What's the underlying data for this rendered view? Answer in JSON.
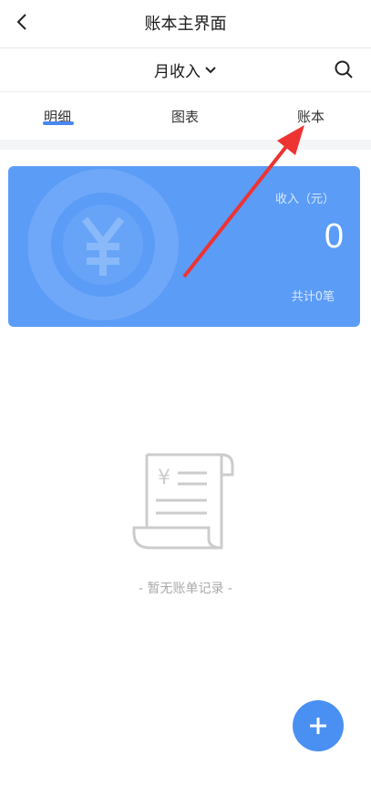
{
  "header": {
    "title": "账本主界面",
    "back_icon": "chevron-left-icon"
  },
  "filter": {
    "label": "月收入",
    "dropdown_icon": "chevron-down-icon",
    "search_icon": "search-icon"
  },
  "tabs": [
    {
      "label": "明细",
      "active": true
    },
    {
      "label": "图表",
      "active": false
    },
    {
      "label": "账本",
      "active": false
    }
  ],
  "card": {
    "caption": "收入（元）",
    "amount": "0",
    "count": "共计0笔",
    "background": "#5b9cf7",
    "watermark_icon": "yuan-icon"
  },
  "empty": {
    "icon": "receipt-icon",
    "text": "- 暂无账单记录 -"
  },
  "fab": {
    "icon": "plus-icon",
    "color": "#4a90f2"
  },
  "accent_color": "#4a86f0",
  "annotation": {
    "color": "#ee3333"
  }
}
